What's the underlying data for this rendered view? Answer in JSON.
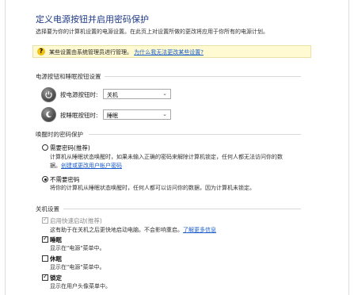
{
  "page": {
    "title": "定义电源按钮并启用密码保护",
    "subtitle": "选择要为你的计算机设置的电源设置。在此页上对设置所做的更改将应用于你所有的电源计划。"
  },
  "info_bar": {
    "text": "某些设置由系统管理员进行管理。",
    "link": "为什么我无法更改某些设置?"
  },
  "power_buttons": {
    "heading": "电源按钮和睡眠按钮设置",
    "power_button": {
      "label": "按电源按钮时:",
      "value": "关机"
    },
    "sleep_button": {
      "label": "按睡眠按钮时:",
      "value": "睡眠"
    }
  },
  "wake_password": {
    "heading": "唤醒时的密码保护",
    "require": {
      "label": "需要密码(推荐)",
      "desc_line1": "计算机从睡眠状态唤醒时，如果未输入正确的密码来解除计算机锁定，任何人都无法访问你的数",
      "desc_line2_prefix": "据。",
      "desc_link": "创建或更改用户帐户密码",
      "selected": false
    },
    "no_require": {
      "label": "不需要密码",
      "desc": "将你的计算机从睡眠状态唤醒时，任何人都可以访问你的数据，因为计算机未锁定。",
      "selected": true
    }
  },
  "shutdown": {
    "heading": "关机设置",
    "fast_startup": {
      "label": "启用快速启动(推荐)",
      "desc_prefix": "这有助于在关机之后更快地启动电脑。不会影响重启。",
      "desc_link": "了解更多信息",
      "checked": true,
      "disabled": true
    },
    "sleep": {
      "label": "睡眠",
      "desc": "显示在\"电源\"菜单中。",
      "checked": true
    },
    "hibernate": {
      "label": "休眠",
      "desc": "显示在\"电源\"菜单中。",
      "checked": false
    },
    "lock": {
      "label": "锁定",
      "desc": "显示在用户头像菜单中。",
      "checked": true
    }
  },
  "icons": {
    "info": "info-icon",
    "power_button": "power-button-icon",
    "sleep_button": "sleep-button-icon",
    "dropdown": "chevron-down-icon",
    "check": "✓",
    "info_glyph": "?"
  },
  "colors": {
    "title": "#1e3a87",
    "link": "#1a5ccc",
    "info_bg": "#fffad1"
  }
}
